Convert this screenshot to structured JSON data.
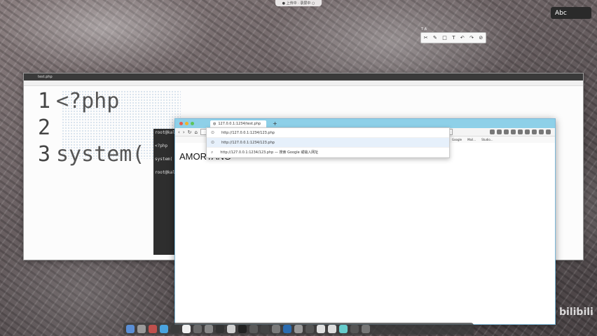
{
  "top_indicator": "● 上传中 · 录屏中 ○",
  "abc_badge": "Abc",
  "annotation_label": "T A",
  "annotation_tools": [
    "✂",
    "✎",
    "□",
    "T",
    "↶",
    "↷",
    "⊘"
  ],
  "editor": {
    "title": "test.php",
    "lines": [
      {
        "num": "1",
        "text": "<?php"
      },
      {
        "num": "2",
        "text": ""
      },
      {
        "num": "3",
        "text": "system("
      }
    ]
  },
  "terminal": {
    "lines": [
      "root@kali:",
      "<?php",
      "system(",
      "root@kali:"
    ]
  },
  "browser": {
    "tab_title": "127.0.0.1:1234/test.php",
    "new_tab": "+",
    "url": "127.0.0.1:1234/test.php",
    "bookmarks": [
      "Google",
      "Mail...",
      "Studio..."
    ],
    "page_text": "AMORTANG",
    "suggestions": [
      {
        "text": "http://127.0.0.1:1234/123.php",
        "active": false
      },
      {
        "text": "http://127.0.0.1:1234/123.php",
        "active": true
      },
      {
        "text": "http://127.0.0.1:1234/123.php — 搜索 Google 或输入网址",
        "active": false
      }
    ]
  },
  "watermark": "bilibili",
  "colors": {
    "browser_tabbar": "#8ed0e8",
    "dot_red": "#e85a4f",
    "dot_yellow": "#f0b429",
    "dot_green": "#5cc45a"
  },
  "dock_items": [
    "#5b8fd6",
    "#9a9a9a",
    "#c0504d",
    "#4aa3df",
    "#3c3c3c",
    "#f0f0f0",
    "#6a6a6a",
    "#888",
    "#333",
    "#d0d0d0",
    "#222",
    "#5a5a5a",
    "#444",
    "#7a7a7a",
    "#2b6cb0",
    "#999",
    "#555",
    "#e0e0e0",
    "#ddd",
    "#6cc",
    "#555",
    "#777"
  ]
}
